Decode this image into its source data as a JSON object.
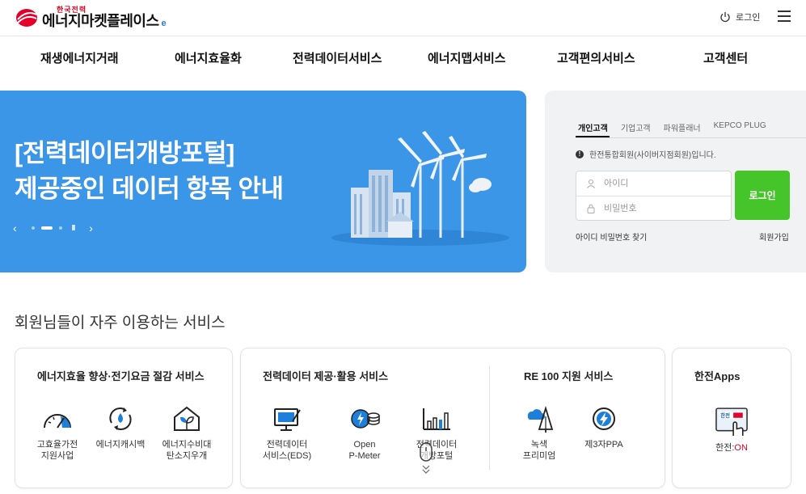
{
  "header": {
    "logo_small": "한국전력",
    "logo_big": "에너지마켓플레이스",
    "logo_badge": "e",
    "login_label": "로그인"
  },
  "nav": {
    "items": [
      "재생에너지거래",
      "에너지효율화",
      "전력데이터서비스",
      "에너지맵서비스",
      "고객편의서비스",
      "고객센터"
    ]
  },
  "hero": {
    "title_line1": "[전력데이터개방포털]",
    "title_line2": "제공중인 데이터 항목 안내",
    "slide_count": 4,
    "active_slide": 2,
    "prev": "‹",
    "next": "›",
    "pause": "II"
  },
  "login_panel": {
    "tabs": [
      "개인고객",
      "기업고객",
      "파워플래너",
      "KEPCO PLUG"
    ],
    "active_tab": "개인고객",
    "notice": "한전통합회원(사이버지점회원)입니다.",
    "id_placeholder": "아이디",
    "pw_placeholder": "비밀번호",
    "login_button": "로그인",
    "find_link": "아이디 비밀번호 찾기",
    "join_link": "회원가입"
  },
  "services": {
    "section_title": "회원님들이 자주 이용하는 서비스",
    "card1": {
      "title": "에너지효율 향상·전기요금 절감 서비스",
      "items": [
        {
          "label": "고효율가전\n지원사업",
          "icon": "gauge-icon"
        },
        {
          "label": "에너지캐시백",
          "icon": "water-drop-cycle-icon"
        },
        {
          "label": "에너지수비대\n탄소지우개",
          "icon": "leaf-house-icon"
        }
      ]
    },
    "card2": {
      "title_a": "전력데이터 제공·활용 서비스",
      "title_b": "RE 100 지원 서비스",
      "items": [
        {
          "label": "전력데이터\n서비스(EDS)",
          "icon": "monitor-pen-icon"
        },
        {
          "label": "Open\nP-Meter",
          "icon": "meter-coins-icon"
        },
        {
          "label": "전력데이터\n개방포털",
          "icon": "bar-chart-icon"
        },
        {
          "label": "녹색\n프리미엄",
          "icon": "cloud-tree-icon"
        },
        {
          "label": "제3자PPA",
          "icon": "lightning-circle-icon"
        }
      ]
    },
    "card3": {
      "title": "한전Apps",
      "app_prefix": "한전:",
      "app_suffix": "ON",
      "icon": "kepco-on-app-icon"
    }
  },
  "colors": {
    "hero_bg": "#3c96e8",
    "login_btn": "#45c52a",
    "brand_red": "#d4001f",
    "accent_blue": "#1d7fd9"
  }
}
